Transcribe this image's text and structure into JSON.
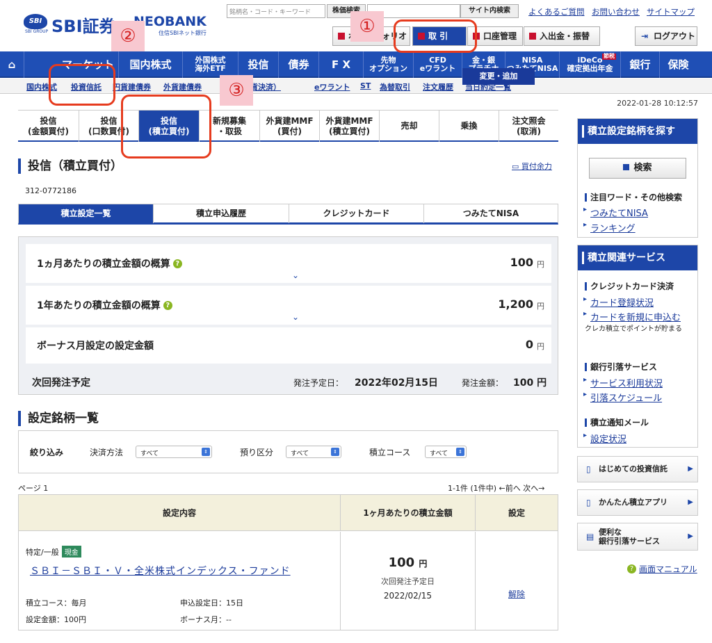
{
  "header": {
    "logo_group": "SBI GROUP",
    "logo_text": "SBI証券",
    "logo_neo": "NEOBANK",
    "logo_neo_sub": "住信SBIネット銀行",
    "search_placeholder": "銘柄名・コード・キーワード",
    "search_btn": "株価検索",
    "site_search_btn": "サイト内検索",
    "links": [
      "よくあるご質問",
      "お問い合わせ",
      "サイトマップ"
    ],
    "buttons": [
      "ポートフォリオ",
      "取 引",
      "口座管理",
      "入出金・振替"
    ],
    "logout": "ログアウト"
  },
  "gnav": [
    "マーケット",
    "国内株式",
    "外国株式\n海外ETF",
    "投信",
    "債券",
    "F X",
    "先物\nオプション",
    "CFD\neワラント",
    "金・銀\nプラチナ",
    "NISA\nつみたてNISA",
    "iDeCo\n確定拠出年金",
    "銀行",
    "保険"
  ],
  "gnav_ideco_badge": "節税",
  "subnav": [
    "国内株式",
    "投資信託",
    "円貨建債券",
    "外貨建債券",
    "FX（円貨決済）",
    "eワラント",
    "ST",
    "為替取引",
    "注文履歴",
    "当日約定一覧"
  ],
  "datetime": "2022-01-28 10:12:57",
  "tabs": [
    "投信\n(金額買付)",
    "投信\n(口数買付)",
    "投信\n(積立買付)",
    "新規募集\n・取扱",
    "外貨建MMF\n(買付)",
    "外貨建MMF\n(積立買付)",
    "売却",
    "乗換",
    "注文照会\n(取消)"
  ],
  "page_title": "投信（積立買付）",
  "buy_room": "買付余力",
  "account": "312-0772186",
  "subtabs": [
    "積立設定一覧",
    "積立申込履歴",
    "クレジットカード",
    "つみたてNISA"
  ],
  "summary": {
    "monthly_label": "1ヵ月あたりの積立金額の概算",
    "monthly_value": "100",
    "yearly_label": "1年あたりの積立金額の概算",
    "yearly_value": "1,200",
    "bonus_label": "ボーナス月設定の設定金額",
    "bonus_value": "0",
    "unit": "円",
    "next_label": "次回発注予定",
    "next_date_label": "発注予定日：",
    "next_date": "2022年02月15日",
    "next_amount_label": "発注金額：",
    "next_amount": "100 円"
  },
  "section2": "設定銘柄一覧",
  "filter": {
    "label": "絞り込み",
    "payment_label": "決済方法",
    "deposit_label": "預り区分",
    "course_label": "積立コース",
    "all": "すべて"
  },
  "page_label": "ページ 1",
  "pager": "1-1件 (1件中) ←前へ  次へ→",
  "table": {
    "headers": [
      "設定内容",
      "1ヶ月あたりの積立金額",
      "設定"
    ],
    "account_type": "特定/一般",
    "badge": "現金",
    "fund": "ＳＢＩ－ＳＢＩ・Ｖ・全米株式インデックス・ファンド",
    "course": "積立コース：毎月",
    "apply_day": "申込設定日：15日",
    "amount": "設定金額：100円",
    "bonus": "ボーナス月：--",
    "monthly": "100",
    "unit": "円",
    "next_label": "次回発注予定日",
    "next_date": "2022/02/15",
    "change_btn": "変更・追加",
    "cancel": "解除"
  },
  "sidebar": {
    "search_title": "積立設定銘柄を探す",
    "search_btn": "検索",
    "keyword_title": "注目ワード・その他検索",
    "keyword_links": [
      "つみたてNISA",
      "ランキング"
    ],
    "service_title": "積立関連サービス",
    "card_title": "クレジットカード決済",
    "card_links": [
      "カード登録状況",
      "カードを新規に申込む"
    ],
    "card_note": "クレカ積立でポイントが貯まる",
    "bank_title": "銀行引落サービス",
    "bank_links": [
      "サービス利用状況",
      "引落スケジュール"
    ],
    "mail_title": "積立通知メール",
    "mail_links": [
      "設定状況"
    ],
    "promo": [
      "はじめての投資信託",
      "かんたん積立アプリ",
      "便利な\n銀行引落サービス"
    ],
    "manual": "画面マニュアル"
  },
  "annotations": [
    "①",
    "②",
    "③"
  ],
  "colors": {
    "brand": "#1d46a8",
    "accent": "#e63b1e",
    "badge": "#2e8a5c"
  }
}
